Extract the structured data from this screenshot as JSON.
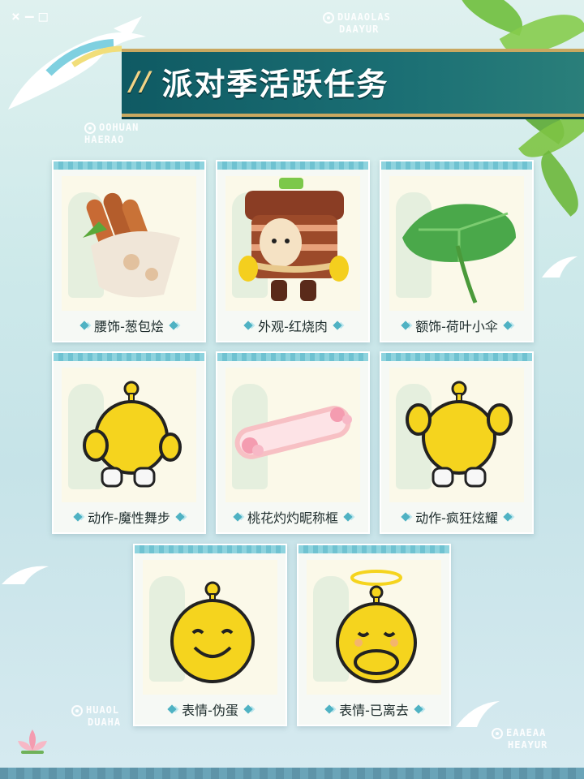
{
  "title": "派对季活跃任务",
  "title_prefix": "//",
  "window_icons": [
    "×",
    "–",
    "□"
  ],
  "deco_logos": [
    {
      "line1": "DUAAOLAS",
      "line2": "DAAYUR"
    },
    {
      "line1": "OOHUAN",
      "line2": "HAERAO"
    },
    {
      "line1": "HUAOL",
      "line2": "DUAHA"
    },
    {
      "line1": "EAAEAA",
      "line2": "HEAYUR"
    }
  ],
  "items": [
    {
      "label": "腰饰-葱包烩",
      "icon": "scallion-roll-icon"
    },
    {
      "label": "外观-红烧肉",
      "icon": "braised-pork-costume-icon"
    },
    {
      "label": "额饰-荷叶小伞",
      "icon": "lotus-leaf-umbrella-icon"
    },
    {
      "label": "动作-魔性舞步",
      "icon": "dance-emote-icon"
    },
    {
      "label": "桃花灼灼昵称框",
      "icon": "peach-blossom-nameplate-icon"
    },
    {
      "label": "动作-疯狂炫耀",
      "icon": "showoff-emote-icon"
    },
    {
      "label": "表情-伪蛋",
      "icon": "smiling-egg-icon"
    },
    {
      "label": "表情-已离去",
      "icon": "angel-egg-icon"
    }
  ],
  "colors": {
    "banner": "#1b6f74",
    "banner_border": "#c9a860",
    "accent": "#4fb2c3",
    "egg_yellow": "#f5d41e"
  }
}
